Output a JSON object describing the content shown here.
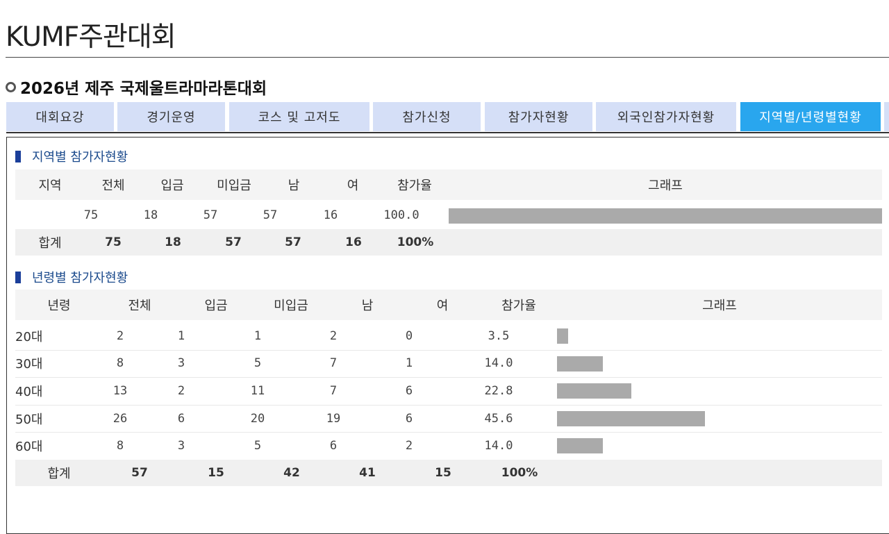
{
  "site": {
    "title": "KUMF주관대회"
  },
  "event": {
    "title": "2026년 제주 국제울트라마라톤대회"
  },
  "tabs": [
    {
      "label": "대회요강"
    },
    {
      "label": "경기운영"
    },
    {
      "label": "코스 및 고저도"
    },
    {
      "label": "참가신청"
    },
    {
      "label": "참가자현황"
    },
    {
      "label": "외국인참가자현황"
    },
    {
      "label": "지역별/년령별현황",
      "active": true
    }
  ],
  "region": {
    "title": "지역별 참가자현황",
    "headers": [
      "지역",
      "전체",
      "입금",
      "미입금",
      "남",
      "여",
      "참가율",
      "그래프"
    ],
    "rows": [
      {
        "region": "",
        "total": "75",
        "paid": "18",
        "unpaid": "57",
        "male": "57",
        "female": "16",
        "rate": "100.0",
        "rate_value": 100.0
      }
    ],
    "sum": {
      "label": "합계",
      "total": "75",
      "paid": "18",
      "unpaid": "57",
      "male": "57",
      "female": "16",
      "rate": "100%"
    }
  },
  "age": {
    "title": "년령별 참가자현황",
    "headers": [
      "년령",
      "전체",
      "입금",
      "미입금",
      "남",
      "여",
      "참가율",
      "그래프"
    ],
    "rows": [
      {
        "age": "20대",
        "total": "2",
        "paid": "1",
        "unpaid": "1",
        "male": "2",
        "female": "0",
        "rate": "3.5",
        "rate_value": 3.5
      },
      {
        "age": "30대",
        "total": "8",
        "paid": "3",
        "unpaid": "5",
        "male": "7",
        "female": "1",
        "rate": "14.0",
        "rate_value": 14.0
      },
      {
        "age": "40대",
        "total": "13",
        "paid": "2",
        "unpaid": "11",
        "male": "7",
        "female": "6",
        "rate": "22.8",
        "rate_value": 22.8
      },
      {
        "age": "50대",
        "total": "26",
        "paid": "6",
        "unpaid": "20",
        "male": "19",
        "female": "6",
        "rate": "45.6",
        "rate_value": 45.6
      },
      {
        "age": "60대",
        "total": "8",
        "paid": "3",
        "unpaid": "5",
        "male": "6",
        "female": "2",
        "rate": "14.0",
        "rate_value": 14.0
      }
    ],
    "sum": {
      "label": "합계",
      "total": "57",
      "paid": "15",
      "unpaid": "42",
      "male": "41",
      "female": "15",
      "rate": "100%"
    }
  },
  "colors": {
    "bar": "#aaaaaa",
    "active_tab": "#29a6ee",
    "tab": "#d5dff7",
    "section_accent": "#1b3f9a"
  }
}
